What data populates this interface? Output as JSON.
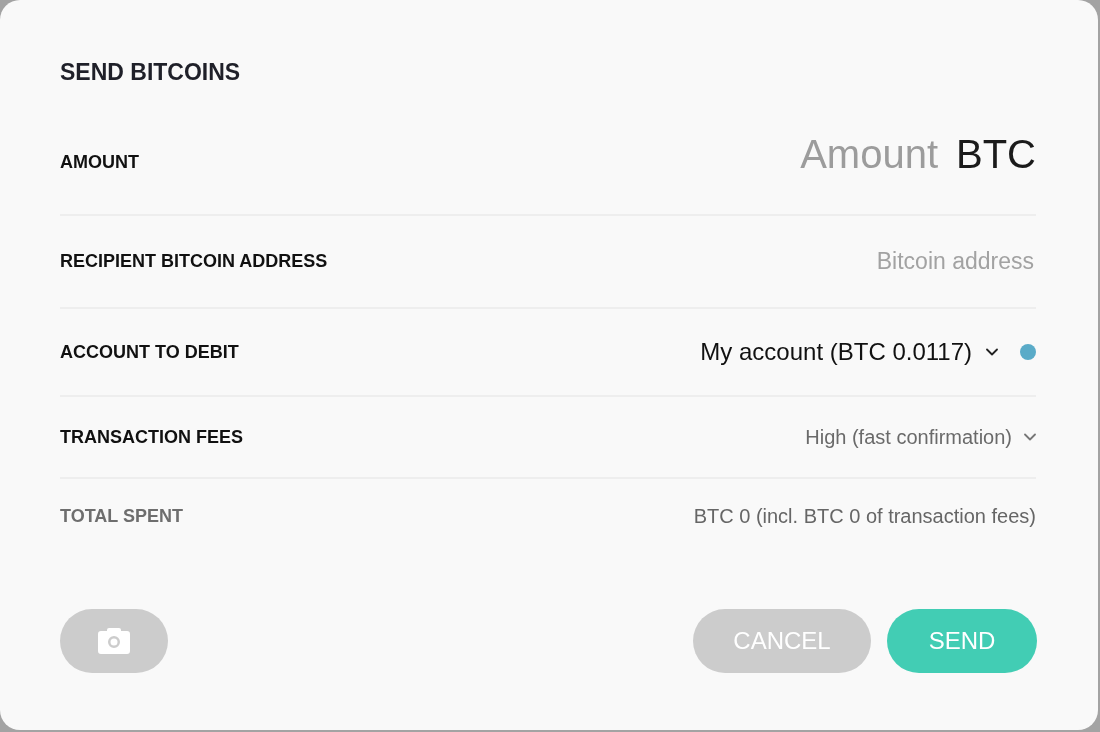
{
  "dialog": {
    "title": "SEND BITCOINS"
  },
  "fields": [
    {
      "kind": "amount",
      "label": "AMOUNT",
      "placeholder": "Amount",
      "unit": "BTC"
    },
    {
      "kind": "address",
      "label": "RECIPIENT BITCOIN ADDRESS",
      "placeholder": "Bitcoin address"
    },
    {
      "kind": "account",
      "label": "ACCOUNT TO DEBIT",
      "value": "My account (BTC 0.0117)",
      "color": "#5aabc8"
    },
    {
      "kind": "fees",
      "label": "TRANSACTION FEES",
      "value": "High (fast confirmation)"
    },
    {
      "kind": "total",
      "label": "TOTAL SPENT",
      "value": "BTC 0 (incl. BTC 0 of transaction fees)"
    }
  ],
  "buttons": [
    {
      "kind": "camera"
    },
    {
      "kind": "cancel",
      "label": "CANCEL"
    },
    {
      "kind": "send",
      "label": "SEND"
    }
  ]
}
